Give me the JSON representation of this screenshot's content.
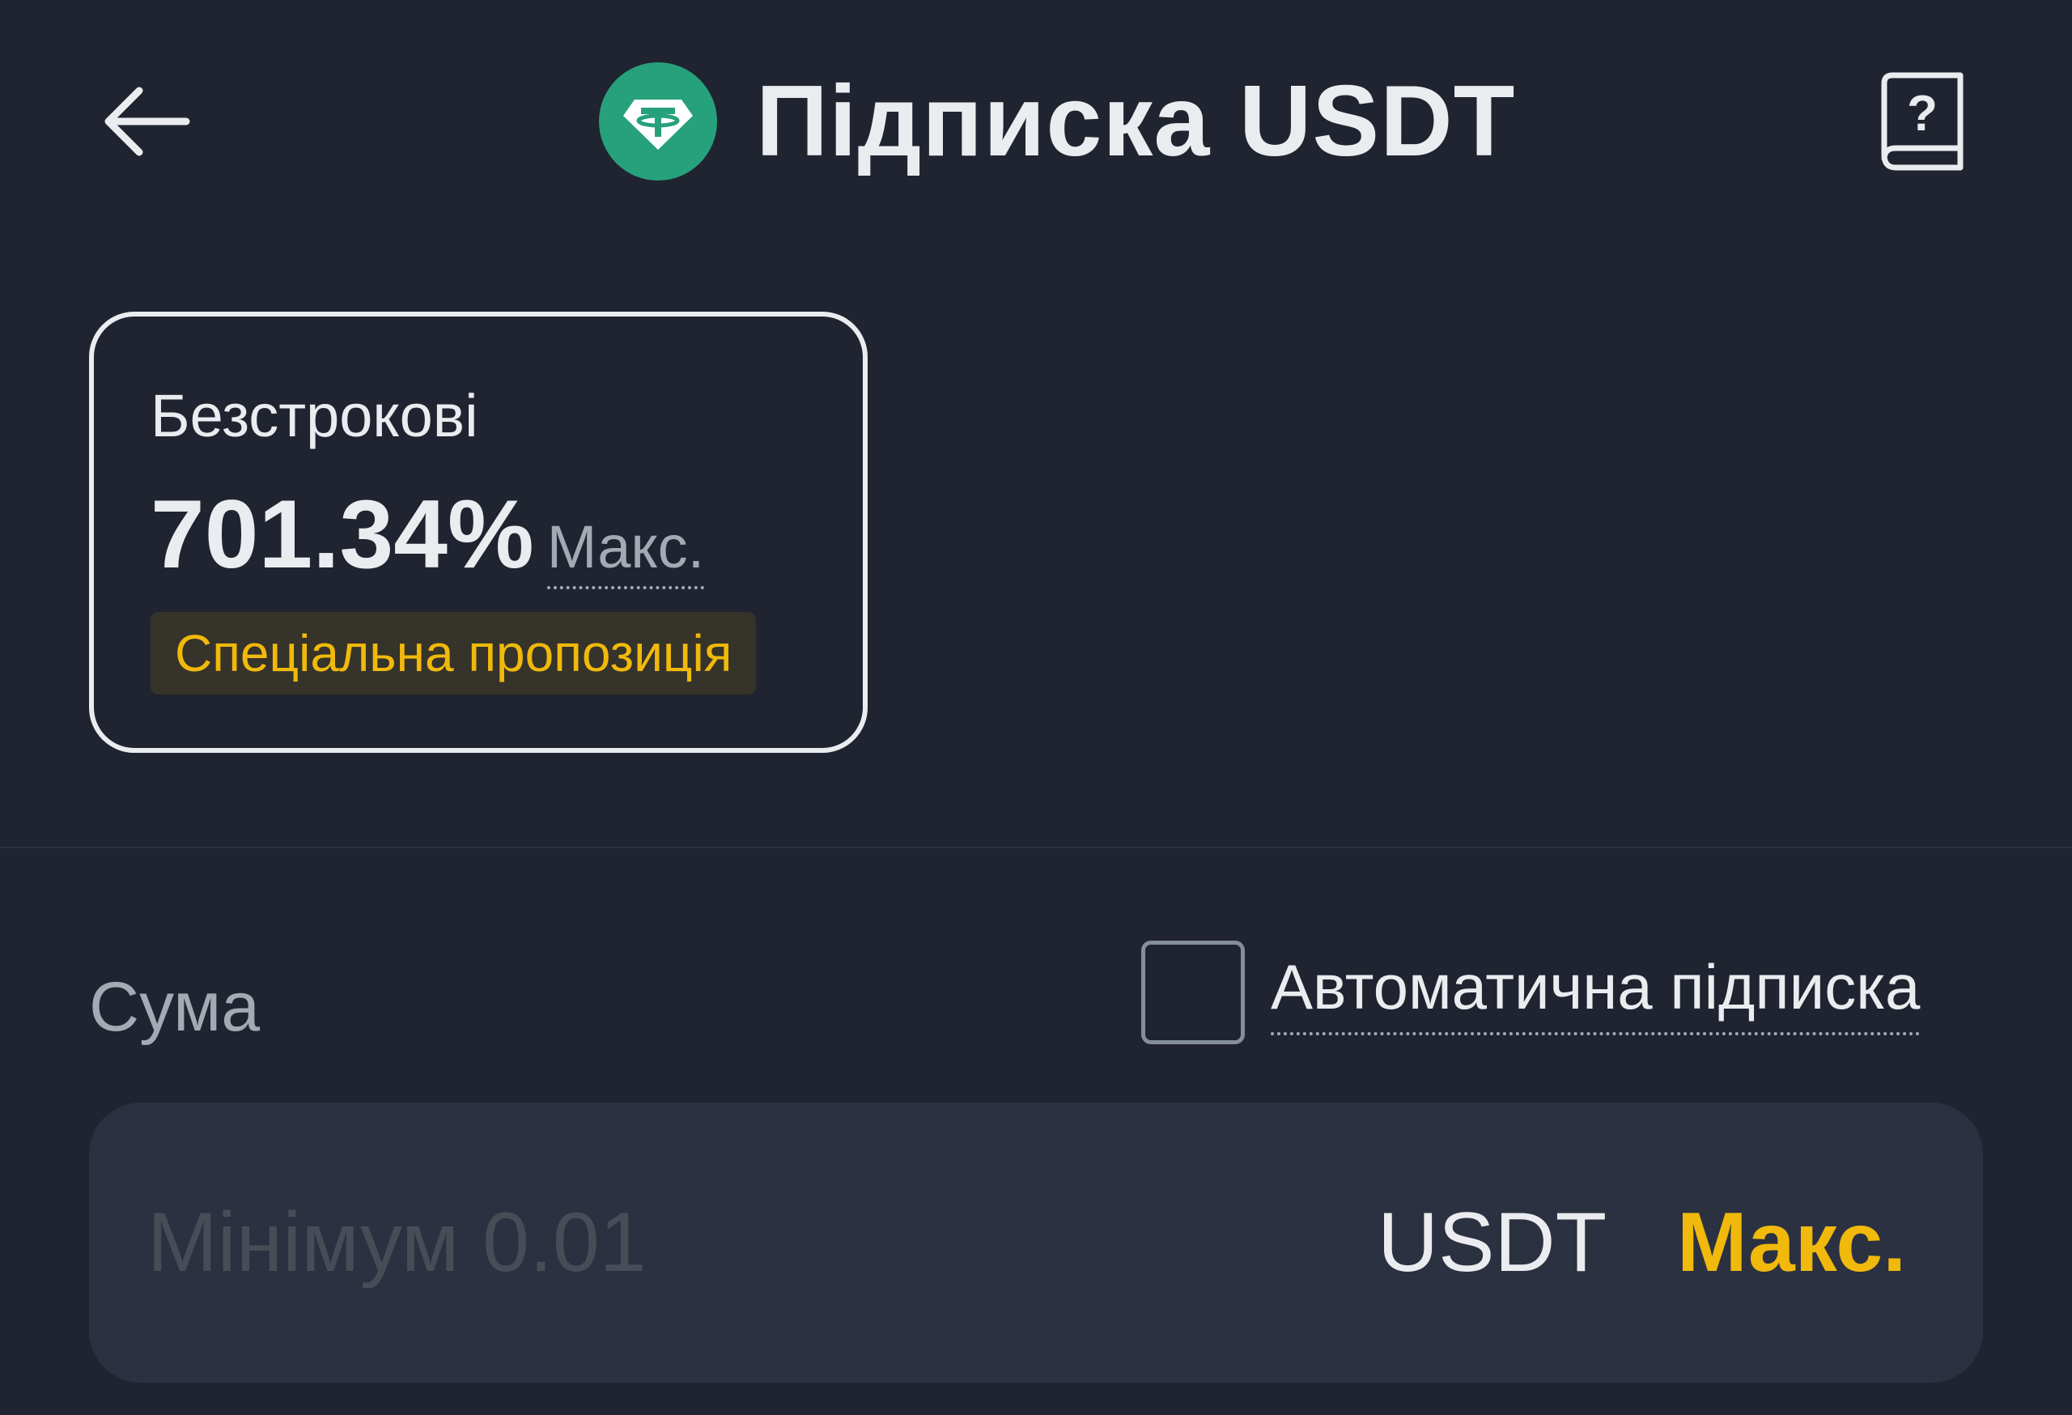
{
  "header": {
    "title": "Підписка USDT",
    "back_icon": "arrow-left-icon",
    "coin_icon": "tether-usdt-icon",
    "help_icon": "help-book-icon"
  },
  "product_card": {
    "term": "Безстрокові",
    "apr": "701.34%",
    "apr_suffix": "Макс.",
    "badge": "Спеціальна пропозиція",
    "selected": true
  },
  "amount": {
    "label": "Сума",
    "auto_subscribe_label": "Автоматична підписка",
    "auto_subscribe_checked": false,
    "input_value": "",
    "input_placeholder": "Мінімум 0.01",
    "currency": "USDT",
    "max_label": "Макс."
  },
  "colors": {
    "background": "#1f2430",
    "surface": "#2b3140",
    "text_primary": "#eaecef",
    "text_secondary": "#a4a9b3",
    "accent": "#f0b90b",
    "tether": "#26a17b"
  }
}
